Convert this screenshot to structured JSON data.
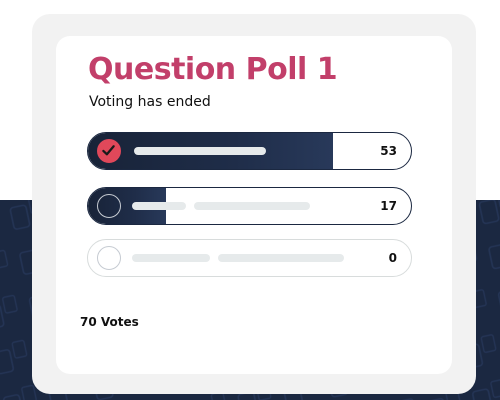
{
  "poll": {
    "title": "Question Poll 1",
    "status": "Voting has ended",
    "total_votes_label": "70 Votes",
    "options": [
      {
        "count": "53",
        "votes": 53,
        "selected": true
      },
      {
        "count": "17",
        "votes": 17,
        "selected": false
      },
      {
        "count": "0",
        "votes": 0,
        "selected": false
      }
    ]
  },
  "icons": {
    "selected_option": "checkmark-icon",
    "unselected_option": "radio-circle-icon",
    "background_pattern": "device-outline-pattern"
  },
  "colors": {
    "title": "#c23f6a",
    "navy": "#1b2841",
    "check_accent": "#e0485a",
    "placeholder_line": "#e6eaeb",
    "card_outer": "#f2f2f2"
  }
}
